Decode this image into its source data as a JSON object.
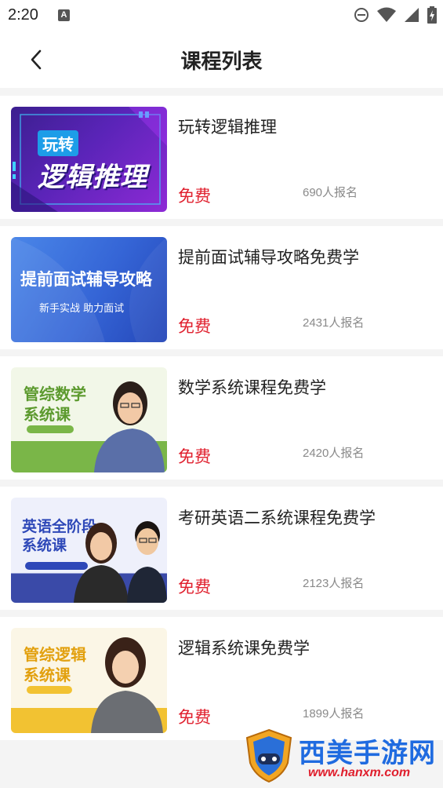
{
  "status_bar": {
    "time": "2:20",
    "notification_icon": "A",
    "icons": [
      "do-not-disturb-icon",
      "wifi-icon",
      "signal-icon",
      "battery-icon"
    ]
  },
  "header": {
    "title": "课程列表",
    "back_icon": "chevron-left-icon"
  },
  "courses": [
    {
      "title": "玩转逻辑推理",
      "price": "免费",
      "enrolled": "690人报名",
      "thumb": {
        "tag": "玩转",
        "main": "逻辑推理"
      }
    },
    {
      "title": "提前面试辅导攻略免费学",
      "price": "免费",
      "enrolled": "2431人报名",
      "thumb": {
        "main": "提前面试辅导攻略",
        "sub": "新手实战   助力面试"
      }
    },
    {
      "title": "数学系统课程免费学",
      "price": "免费",
      "enrolled": "2420人报名",
      "thumb": {
        "line1": "管综数学",
        "line2": "系统课"
      }
    },
    {
      "title": "考研英语二系统课程免费学",
      "price": "免费",
      "enrolled": "2123人报名",
      "thumb": {
        "line1": "英语全阶段",
        "line2": "系统课"
      }
    },
    {
      "title": "逻辑系统课免费学",
      "price": "免费",
      "enrolled": "1899人报名",
      "thumb": {
        "line1": "管综逻辑",
        "line2": "系统课"
      }
    }
  ],
  "watermark": {
    "brand": "西美手游网",
    "url": "www.hanxm.com"
  },
  "colors": {
    "price": "#e0202e",
    "accent_purple": "#7a2de0",
    "accent_blue": "#3f6fd8",
    "accent_green": "#7ab648",
    "watermark_blue": "#1f6be0"
  }
}
